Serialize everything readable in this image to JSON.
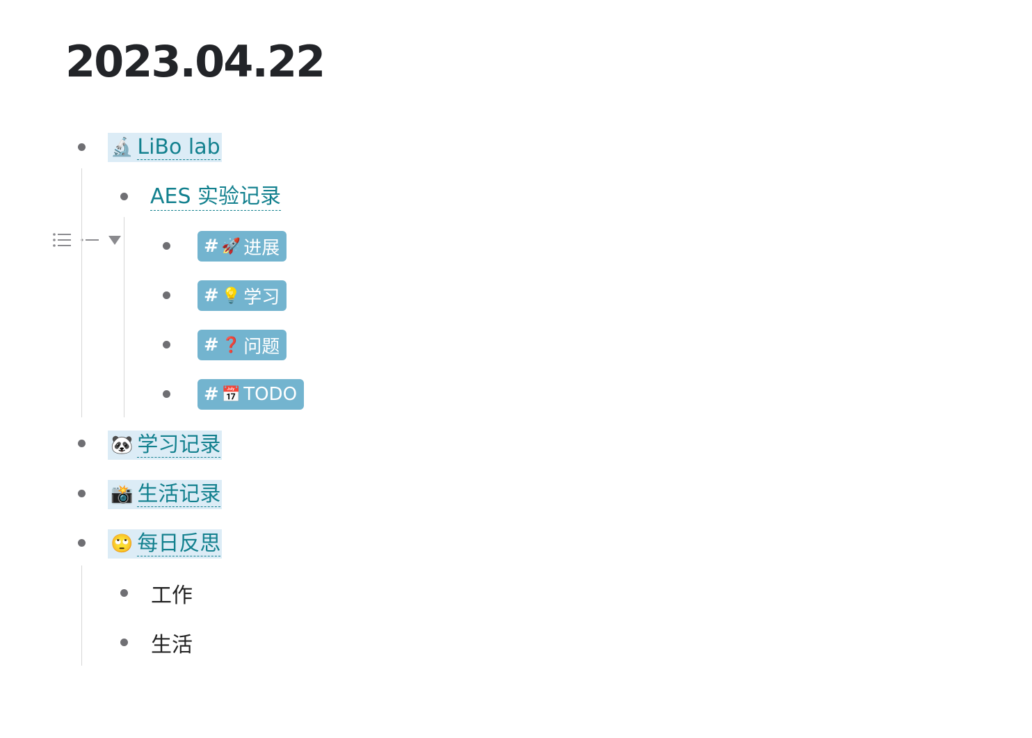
{
  "page": {
    "title": "2023.04.22"
  },
  "blocks": {
    "libo_lab": {
      "emoji": "🔬",
      "label": "LiBo lab"
    },
    "aes_record": {
      "label": "AES 实验记录"
    },
    "tags": [
      {
        "hash": "#",
        "emoji": "🚀",
        "label": "进展"
      },
      {
        "hash": "#",
        "emoji": "💡",
        "label": "学习"
      },
      {
        "hash": "#",
        "emoji": "❓",
        "label": "问题"
      },
      {
        "hash": "#",
        "emoji": "📅",
        "label": "TODO"
      }
    ],
    "study_record": {
      "emoji": "🐼",
      "label": "学习记录"
    },
    "life_record": {
      "emoji": "📸",
      "label": "生活记录"
    },
    "daily_reflection": {
      "emoji": "🙄",
      "label": "每日反思"
    },
    "work": {
      "label": "工作"
    },
    "life": {
      "label": "生活"
    }
  },
  "toolbar": {
    "list_icon": "list-icon",
    "collapse_icon": "collapse-line-icon",
    "triangle_icon": "triangle-down-icon"
  },
  "colors": {
    "link": "#12808e",
    "page_ref_bg": "#dcecf6",
    "tag_bg": "#73b4cf",
    "bullet": "#6f6f73"
  }
}
